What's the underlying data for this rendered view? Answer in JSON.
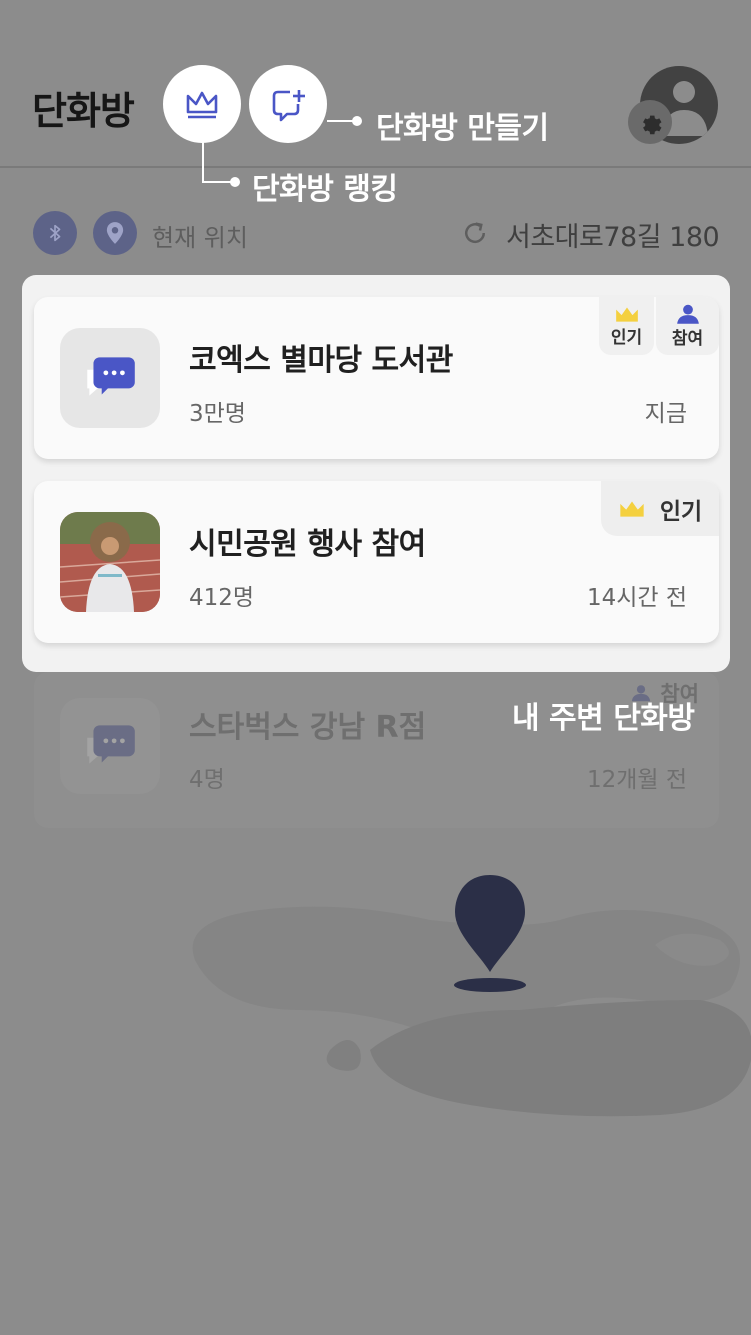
{
  "header": {
    "title": "단화방"
  },
  "callouts": {
    "create": "단화방 만들기",
    "ranking": "단화방 랭킹",
    "nearby": "내 주변 단화방"
  },
  "location": {
    "label": "현재 위치",
    "address": "서초대로78길 180"
  },
  "rooms": [
    {
      "title": "코엑스 별마당 도서관",
      "count": "3만명",
      "time": "지금",
      "badges": [
        "인기",
        "참여"
      ]
    },
    {
      "title": "시민공원 행사 참여",
      "count": "412명",
      "time": "14시간 전",
      "badges": [
        "인기"
      ]
    },
    {
      "title": "스타벅스 강남 R점",
      "count": "4명",
      "time": "12개월 전",
      "badges": [
        "참여"
      ]
    }
  ],
  "colors": {
    "accent": "#4a56c6",
    "crown": "#f4d03f",
    "pin": "#2b2f47"
  },
  "icons": {
    "ranking": "crown-icon",
    "create": "chat-add-icon",
    "settings": "gear-icon",
    "bluetooth": "bluetooth-icon",
    "location": "location-pin-icon",
    "refresh": "refresh-icon"
  }
}
